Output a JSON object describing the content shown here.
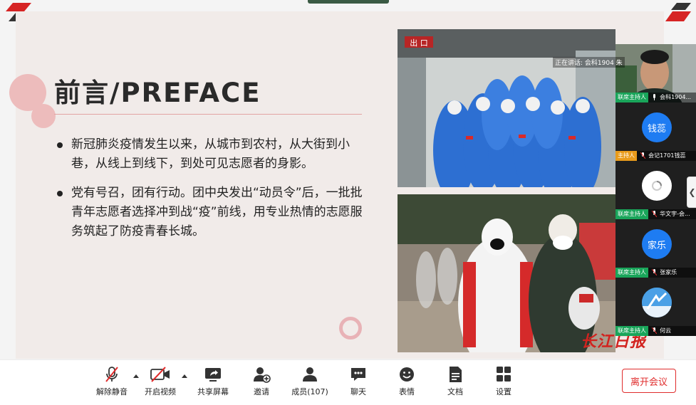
{
  "slide": {
    "title": "前言/PREFACE",
    "bullets": [
      "新冠肺炎疫情发生以来，从城市到农村，从大街到小巷，从线上到线下，到处可见志愿者的身影。",
      "党有号召，团有行动。团中央发出“动员令”后，一批批青年志愿者选择冲到战“疫”前线，用专业热情的志愿服务筑起了防疫青春长城。"
    ],
    "photo1_sign": "出 口",
    "watermark": "长江日报"
  },
  "speaker_overlay": "正在讲话: 会科1904 朱",
  "participants": [
    {
      "type": "video",
      "role": "联席主持人",
      "name": "会科1904..."
    },
    {
      "type": "avatar",
      "avatar_text": "钱蕊",
      "role": "主持人",
      "name": "会记1701钱蕊"
    },
    {
      "type": "loading",
      "role": "联席主持人",
      "name": "华文宇-会..."
    },
    {
      "type": "avatar",
      "avatar_text": "家乐",
      "role": "联席主持人",
      "name": "张家乐"
    },
    {
      "type": "image",
      "role": "联席主持人",
      "name": "何云"
    }
  ],
  "toolbar": {
    "mute": "解除静音",
    "video": "开启视频",
    "share": "共享屏幕",
    "invite": "邀请",
    "members": "成员(107)",
    "chat": "聊天",
    "reactions": "表情",
    "docs": "文档",
    "settings": "设置",
    "leave": "离开会议"
  },
  "colors": {
    "accent_red": "#e02c2c",
    "cohost_tag": "#19a55a",
    "host_tag": "#e99b1b",
    "avatar_blue": "#1e7cf2",
    "slide_bg": "#f1ebe9"
  }
}
